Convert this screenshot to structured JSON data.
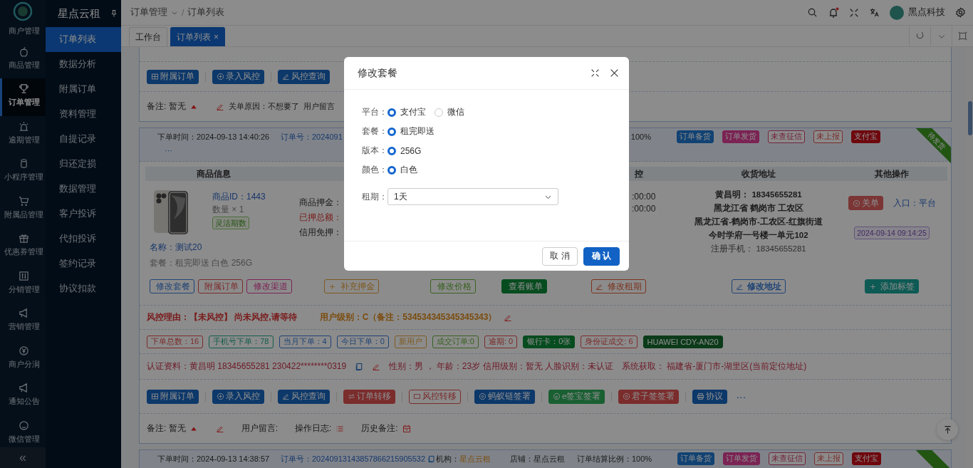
{
  "rail": {
    "items": [
      {
        "label": "商户管理",
        "selected": false
      },
      {
        "label": "商品管理",
        "selected": false
      },
      {
        "label": "订单管理",
        "selected": true
      },
      {
        "label": "逾期管理",
        "selected": false
      },
      {
        "label": "小程序管理",
        "selected": false
      },
      {
        "label": "附属品管理",
        "selected": false
      },
      {
        "label": "优惠券管理",
        "selected": false
      },
      {
        "label": "分销管理",
        "selected": false
      },
      {
        "label": "营销管理",
        "selected": false
      },
      {
        "label": "商户分润",
        "selected": false
      },
      {
        "label": "通知公告",
        "selected": false
      },
      {
        "label": "微信管理",
        "selected": false
      }
    ],
    "collapse": "«"
  },
  "submenu": {
    "title": "星点云租",
    "items": [
      {
        "label": "订单列表",
        "selected": true
      },
      {
        "label": "数据分析",
        "selected": false
      },
      {
        "label": "附属订单",
        "selected": false
      },
      {
        "label": "资料管理",
        "selected": false
      },
      {
        "label": "自提记录",
        "selected": false
      },
      {
        "label": "归还定损",
        "selected": false
      },
      {
        "label": "数据管理",
        "selected": false
      },
      {
        "label": "客户投诉",
        "selected": false
      },
      {
        "label": "代扣投诉",
        "selected": false
      },
      {
        "label": "签约记录",
        "selected": false
      },
      {
        "label": "协议扣款",
        "selected": false
      }
    ]
  },
  "header": {
    "breadcrumb": [
      "订单管理",
      "订单列表"
    ],
    "breadcrumb_separator": "/",
    "notifications_unread": true,
    "user": "黑点科技"
  },
  "tabs": [
    {
      "label": "工作台",
      "selected": false
    },
    {
      "label": "订单列表",
      "selected": true,
      "close": "×"
    }
  ],
  "orders": [
    {
      "actions": [
        {
          "label": "附属订单",
          "kind": "navy"
        },
        {
          "label": "录入风控",
          "kind": "navy"
        },
        {
          "label": "风控查询",
          "kind": "navy"
        }
      ],
      "remark": {
        "text": "备注: 暂无",
        "close_reason": "关单原因：不想要了",
        "message": "用户留言"
      }
    },
    {
      "header": {
        "time": "下单时间：2024-09-13 14:40:26",
        "order_no": "订单号：2024091",
        "ratio": "100%",
        "more": "···",
        "ribbon": "待发货",
        "tags": [
          {
            "label": "订单备货",
            "kind": "primary"
          },
          {
            "label": "订单发货",
            "kind": "pink"
          },
          {
            "label": "未查征信",
            "kind": "outline-rose"
          },
          {
            "label": "未上报",
            "kind": "outline-danger"
          },
          {
            "label": "支付宝",
            "kind": "alipay"
          }
        ]
      },
      "table": {
        "columns": [
          "商品信息",
          "控",
          "收货地址",
          "其他操作"
        ],
        "product": {
          "id": "商品ID：1443",
          "qty": "数量 × 1",
          "tag": "灵活期数",
          "name": "名称：测试20",
          "package": "套餐：租完即送 白色 256G",
          "buttons": [
            {
              "label": "修改套餐",
              "kind": "outline-blue"
            },
            {
              "label": "附属订单",
              "kind": "outline-danger"
            },
            {
              "label": "修改渠道",
              "kind": "outline-pink"
            }
          ]
        },
        "deposit": {
          "goods": "商品押金：",
          "paid": "已押总额：",
          "credit": "信用免押：",
          "buttons": [
            {
              "label": "补充押金",
              "kind": "outline-warning"
            }
          ]
        },
        "column_3": {
          "buttons": [
            {
              "label": "修改价格",
              "kind": "outline-success"
            },
            {
              "label": "查看账单",
              "kind": "green"
            }
          ]
        },
        "risk": {
          "times": [
            ":00:00",
            ":00:00"
          ],
          "buttons": [
            {
              "label": "修改租期",
              "kind": "outline-orange"
            }
          ]
        },
        "address": {
          "contact": "黄昌明：  18345655281",
          "region": "黑龙江省 鹤岗市 工农区",
          "detail": "黑龙江省-鹤岗市-工农区-红旗街道今时学府一号楼一单元102",
          "phone": "注册手机：  18345655281",
          "buttons": [
            {
              "label": "修改地址",
              "kind": "outline-blue"
            }
          ]
        },
        "other": {
          "close": "关单",
          "entry": "入口：平台",
          "date": "2024-09-14 09:14:25",
          "buttons": [
            {
              "label": "添加标签",
              "kind": "cyan"
            }
          ]
        }
      },
      "risk": {
        "reason": "风控理由：【未风控】 尚未风控,请等待",
        "level": "用户级别：C（备注：534534345345345343）"
      },
      "stats": [
        {
          "label": "下单总数：16",
          "kind": "outline-danger"
        },
        {
          "label": "手机号下单：78",
          "kind": "outline-teal"
        },
        {
          "label": "当月下单：4",
          "kind": "outline-blue"
        },
        {
          "label": "今日下单：0",
          "kind": "outline-blue"
        },
        {
          "label": "新用户",
          "kind": "outline-warning"
        },
        {
          "label": "成交订单:0",
          "kind": "outline-success"
        },
        {
          "label": "逾期: 0",
          "kind": "outline-danger"
        },
        {
          "label": "银行卡：0张",
          "kind": "green"
        },
        {
          "label": "身份证成交: 6",
          "kind": "outline-danger"
        },
        {
          "label": "HUAWEI CDY-AN20",
          "kind": "forest"
        }
      ],
      "cert": {
        "identity": "认证资料：黄昌明  18345655281  230422********0319",
        "profile": "性别：男 ，  年龄：23岁   信用级别：暂无   人脸识别：未认证",
        "location": "系统获取：  福建省-厦门市-湖里区(当前定位地址)"
      },
      "actions": [
        {
          "label": "附属订单",
          "kind": "navy"
        },
        {
          "label": "录入风控",
          "kind": "navy"
        },
        {
          "label": "风控查询",
          "kind": "navy"
        },
        {
          "label": "订单转移",
          "kind": "danger"
        },
        {
          "label": "风控转移",
          "kind": "outline-danger"
        },
        {
          "label": "蚂蚁链签署",
          "kind": "navy"
        },
        {
          "label": "e签宝签署",
          "kind": "emerald"
        },
        {
          "label": "君子签签署",
          "kind": "danger"
        },
        {
          "label": "协议",
          "kind": "navy"
        }
      ],
      "more": "···",
      "remark": {
        "text": "备注: 暂无",
        "message": "用户留言:",
        "log": "操作日志:",
        "history": "历史备注:"
      }
    },
    {
      "header": {
        "time": "下单时间：2024-09-13 14:38:57",
        "order_no": "订单号：20240913143857866215905532",
        "org_label": "机构：",
        "org": "星点云租",
        "shop": "店铺：星点云租",
        "ratio": "订单结算比例：100%",
        "tags": [
          {
            "label": "订单备货",
            "kind": "primary"
          },
          {
            "label": "订单发货",
            "kind": "pink"
          },
          {
            "label": "未查征信",
            "kind": "outline-rose"
          },
          {
            "label": "未上报",
            "kind": "outline-danger"
          },
          {
            "label": "支付宝",
            "kind": "alipay"
          }
        ]
      }
    }
  ],
  "dialog": {
    "title": "修改套餐",
    "fields": [
      {
        "label": "平台：",
        "kind": "radio",
        "options": [
          {
            "label": "支付宝",
            "selected": true
          },
          {
            "label": "微信",
            "selected": false
          }
        ]
      },
      {
        "label": "套餐：",
        "kind": "radio",
        "options": [
          {
            "label": "租完即送",
            "selected": true
          }
        ]
      },
      {
        "label": "版本：",
        "kind": "radio",
        "options": [
          {
            "label": "256G",
            "selected": true
          }
        ]
      },
      {
        "label": "颜色：",
        "kind": "radio",
        "options": [
          {
            "label": "白色",
            "selected": true
          }
        ]
      },
      {
        "label": "租期：",
        "kind": "select",
        "value": "1天"
      }
    ],
    "cancel": "取 消",
    "confirm": "确 认"
  }
}
